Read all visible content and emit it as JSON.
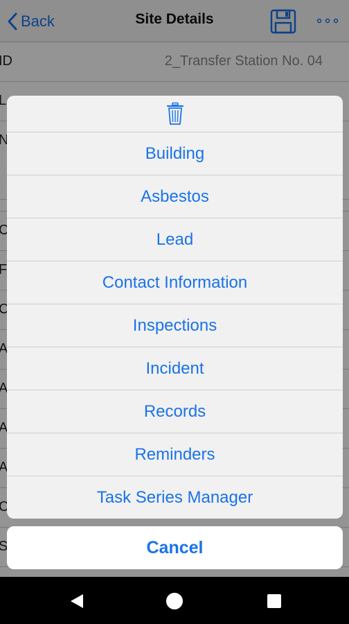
{
  "header": {
    "back_label": "Back",
    "title": "Site Details",
    "save_icon": "save-icon",
    "more_icon": "more-horizontal-icon"
  },
  "fields": [
    {
      "label": "ID",
      "value": "2_Transfer Station No. 04"
    },
    {
      "label": "L",
      "value": ""
    },
    {
      "label": "N",
      "value": ""
    },
    {
      "label": "",
      "value": ""
    },
    {
      "label": "C",
      "value": ""
    },
    {
      "label": "F",
      "value": ""
    },
    {
      "label": "C",
      "value": ""
    },
    {
      "label": "A",
      "value": ""
    },
    {
      "label": "A",
      "value": ""
    },
    {
      "label": "A",
      "value": ""
    },
    {
      "label": "A",
      "value": ""
    },
    {
      "label": "C",
      "value": ""
    },
    {
      "label": "S",
      "value": ""
    }
  ],
  "action_sheet": {
    "delete_icon": "trash-icon",
    "items": [
      "Building",
      "Asbestos",
      "Lead",
      "Contact Information",
      "Inspections",
      "Incident",
      "Records",
      "Reminders",
      "Task Series Manager"
    ],
    "cancel_label": "Cancel"
  },
  "system_nav": {
    "back": "back-triangle-icon",
    "home": "home-circle-icon",
    "recents": "recents-square-icon"
  },
  "colors": {
    "accent": "#1a73e8",
    "sheet_bg": "#f1f1f1",
    "overlay": "rgba(0,0,0,0.42)"
  }
}
